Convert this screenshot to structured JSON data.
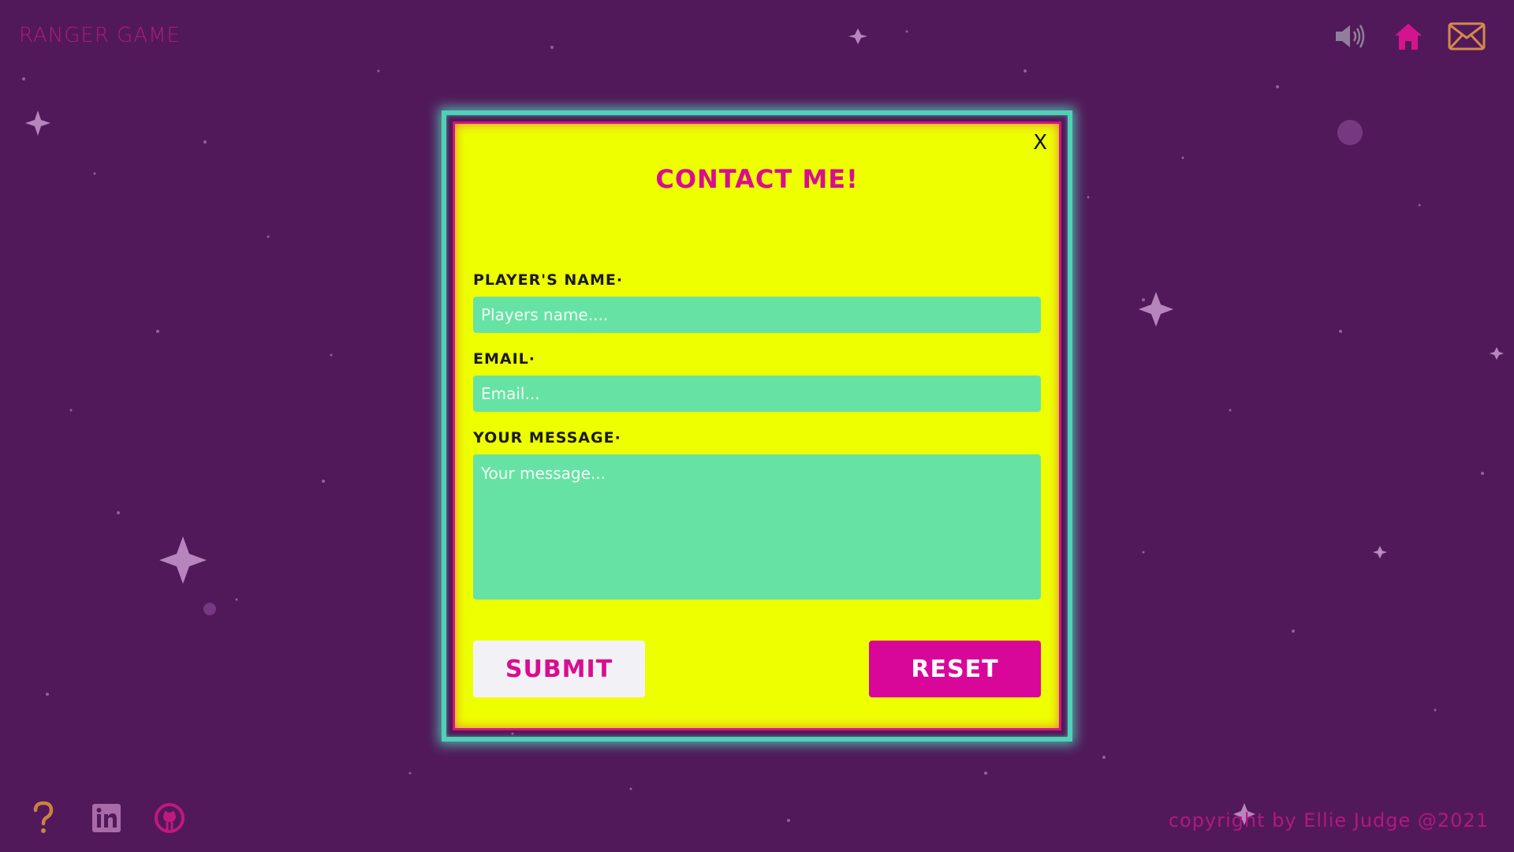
{
  "header": {
    "brand": "RANGER GAME",
    "icons": [
      "speaker-icon",
      "home-icon",
      "mail-icon"
    ]
  },
  "modal": {
    "close_label": "X",
    "title": "CONTACT ME!",
    "fields": {
      "name_label": "PLAYER'S NAME·",
      "name_placeholder": "Players name....",
      "email_label": "EMAIL·",
      "email_placeholder": "Email...",
      "message_label": "YOUR MESSAGE·",
      "message_placeholder": "Your message..."
    },
    "submit_label": "SUBMIT",
    "reset_label": "RESET"
  },
  "footer": {
    "icons": [
      "help-icon",
      "linkedin-icon",
      "github-icon"
    ],
    "copyright": "copyright by Ellie Judge @2021"
  },
  "colors": {
    "background": "#52195a",
    "modal": "#eeff00",
    "accent": "#d90d8f",
    "field": "#66e3a4",
    "frame": "#4fd1b8"
  }
}
